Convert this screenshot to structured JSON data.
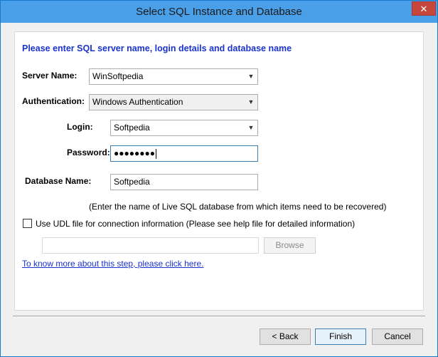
{
  "window": {
    "title": "Select SQL Instance and Database",
    "close_label": "✕"
  },
  "form": {
    "header": "Please enter SQL server name, login details and database name",
    "server_name": {
      "label": "Server Name:",
      "value": "WinSoftpedia"
    },
    "authentication": {
      "label": "Authentication:",
      "value": "Windows Authentication"
    },
    "login": {
      "label": "Login:",
      "value": "Softpedia"
    },
    "password": {
      "label": "Password:",
      "value": "●●●●●●●●"
    },
    "database": {
      "label": "Database Name:",
      "value": "Softpedia"
    },
    "hint": "(Enter the name of Live SQL database from which items need to be recovered)",
    "udl": {
      "label": "Use UDL file for connection information (Please see help file for detailed information)",
      "checked": false,
      "path_value": "",
      "browse_label": "Browse"
    },
    "help_link": "To know more about this step, please click here."
  },
  "footer": {
    "back_label": "< Back",
    "finish_label": "Finish",
    "cancel_label": "Cancel"
  },
  "colors": {
    "title_bar": "#4aa0e8",
    "accent_text": "#1a33cc",
    "close_button": "#c7463b"
  },
  "icons": {
    "dropdown": "chevron-down-icon",
    "close": "close-icon"
  }
}
